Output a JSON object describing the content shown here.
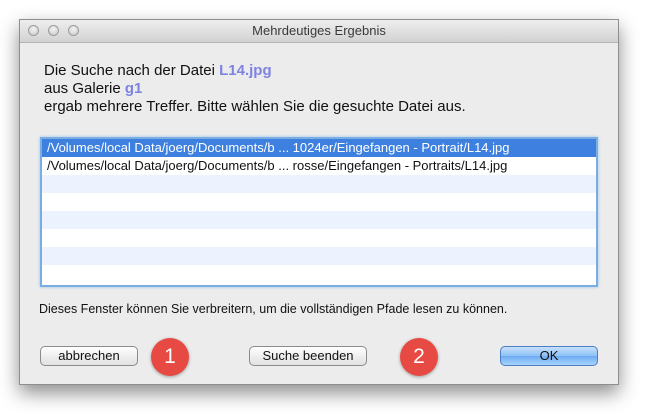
{
  "window": {
    "title": "Mehrdeutiges Ergebnis"
  },
  "message": {
    "line1_prefix": "Die Suche nach der Datei ",
    "filename": "L14.jpg",
    "line2_prefix": "aus Galerie ",
    "gallery": "g1",
    "line3": "ergab mehrere Treffer. Bitte wählen Sie die gesuchte Datei aus."
  },
  "results": {
    "items": [
      "/Volumes/local Data/joerg/Documents/b ... 1024er/Eingefangen - Portrait/L14.jpg",
      "/Volumes/local Data/joerg/Documents/b ... rosse/Eingefangen - Portraits/L14.jpg"
    ],
    "selected_index": 0
  },
  "hint": "Dieses Fenster können Sie verbreitern, um die vollständigen Pfade lesen zu können.",
  "buttons": {
    "cancel": "abbrechen",
    "stop": "Suche beenden",
    "ok": "OK"
  },
  "badges": [
    "1",
    "2"
  ],
  "colors": {
    "highlight_text": "#7d83e0",
    "selection": "#3d80df",
    "badge": "#e74a43"
  }
}
